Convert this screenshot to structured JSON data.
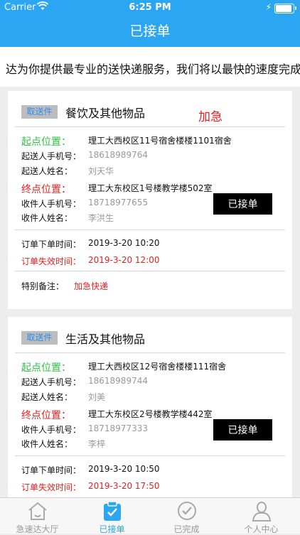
{
  "status": {
    "carrier": "Carrier",
    "time": "6:25 PM"
  },
  "nav": {
    "title": "已接单"
  },
  "marquee": {
    "text": "达为你提供最专业的送快递服务，我们将以最快的速度完成"
  },
  "orders": [
    {
      "tag": "取送件",
      "category": "餐饮及其他物品",
      "urgent": "加急",
      "start_label": "起点位置：",
      "start_value": "理工大西校区11号宿舍楼楼1101宿舍",
      "sender_phone_label": "起送人手机号：",
      "sender_phone": "18618989764",
      "sender_name_label": "起送人姓名：",
      "sender_name": "刘天华",
      "end_label": "终点位置：",
      "end_value": "理工大东校区1号楼教学楼502室",
      "receiver_phone_label": "收件人手机号：",
      "receiver_phone": "18718977655",
      "receiver_name_label": "收件人姓名：",
      "receiver_name": "李洪生",
      "button": "已接单",
      "order_time_label": "订单下单时间：",
      "order_time": "2019-3-20 10:20",
      "expire_label": "订单失效时间：",
      "expire_time": "2019-3-20 12:00",
      "remark_label": "特别备注：",
      "remark": "加急快递"
    },
    {
      "tag": "取送件",
      "category": "生活及其他物品",
      "start_label": "起点位置：",
      "start_value": "理工大西校区12号宿舍楼楼111宿舍",
      "sender_phone_label": "起送人手机号：",
      "sender_phone": "18618989744",
      "sender_name_label": "起送人姓名：",
      "sender_name": "刘美",
      "end_label": "终点位置：",
      "end_value": "理工大东校区2号楼教学楼442室",
      "receiver_phone_label": "收件人手机号：",
      "receiver_phone": "18718977333",
      "receiver_name_label": "收件人姓名：",
      "receiver_name": "李梓",
      "button": "已接单",
      "order_time_label": "订单下单时间：",
      "order_time": "2019-3-20 10:50",
      "expire_label": "订单失效时间：",
      "expire_time": "2019-3-20 17:50"
    }
  ],
  "tabs": [
    {
      "label": "急速达大厅",
      "icon": "house-icon"
    },
    {
      "label": "已接单",
      "icon": "clipboard-icon"
    },
    {
      "label": "已完成",
      "icon": "check-circle-icon"
    },
    {
      "label": "个人中心",
      "icon": "person-icon"
    }
  ],
  "colors": {
    "primary": "#2aa6f2",
    "start": "#2fc044",
    "end": "#e52020",
    "button": "#000000"
  }
}
